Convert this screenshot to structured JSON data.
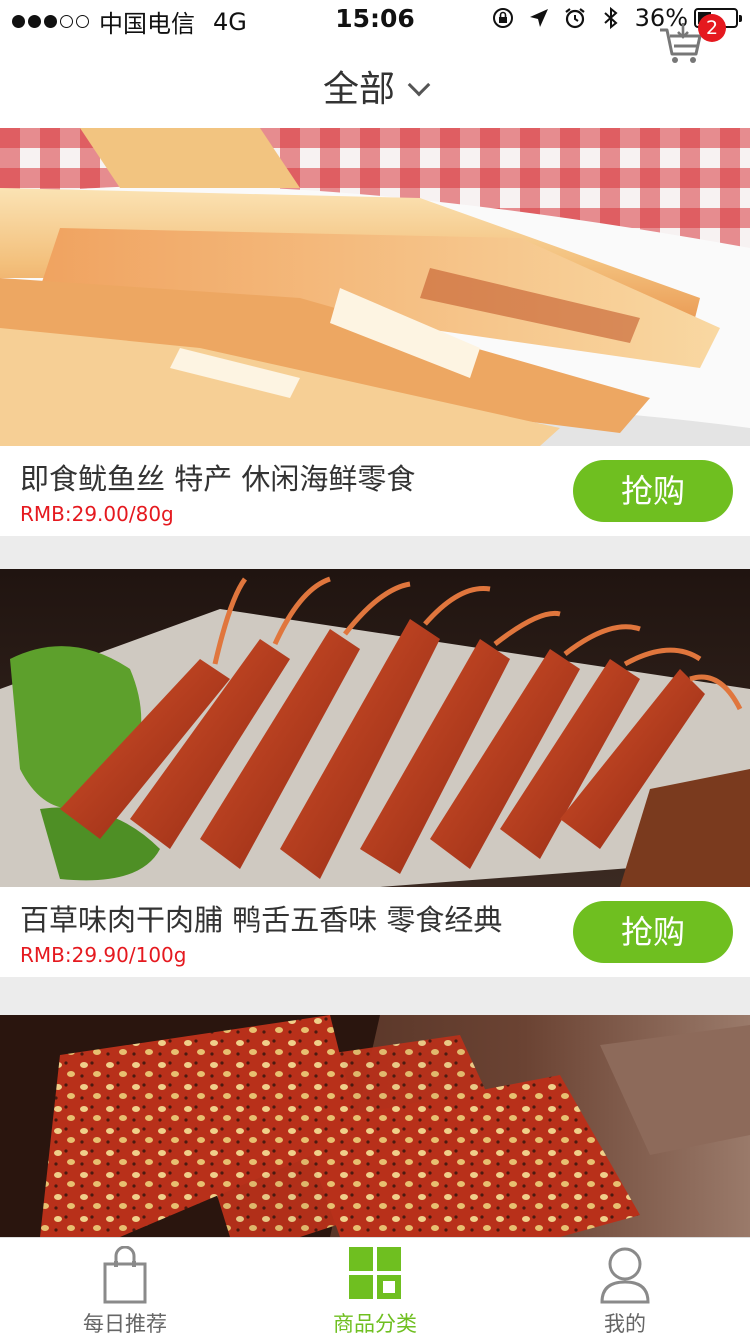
{
  "status_bar": {
    "carrier": "中国电信",
    "network": "4G",
    "time": "15:06",
    "battery": "36%",
    "battery_level": 0.36,
    "signal_bars": 3,
    "signal_total": 5
  },
  "header": {
    "title": "全部",
    "cart_badge": "2",
    "cart_icon": "shopping-cart-icon"
  },
  "products": [
    {
      "name": "即食鱿鱼丝 特产 休闲海鲜零食",
      "price": "RMB:29.00/80g",
      "button": "抢购",
      "image": "dried-squid-photo"
    },
    {
      "name": "百草味肉干肉脯 鸭舌五香味 零食经典",
      "price": "RMB:29.90/100g",
      "button": "抢购",
      "image": "duck-tongue-photo"
    },
    {
      "name": "",
      "price": "",
      "button": "",
      "image": "pork-jerky-photo"
    }
  ],
  "tab_bar": {
    "tabs": [
      {
        "label": "每日推荐",
        "icon": "shopping-bag-icon",
        "active": false
      },
      {
        "label": "商品分类",
        "icon": "category-grid-icon",
        "active": true
      },
      {
        "label": "我的",
        "icon": "user-icon",
        "active": false
      }
    ]
  },
  "colors": {
    "accent": "#6fbf20",
    "price": "#e5191f",
    "badge": "#e5191f"
  }
}
